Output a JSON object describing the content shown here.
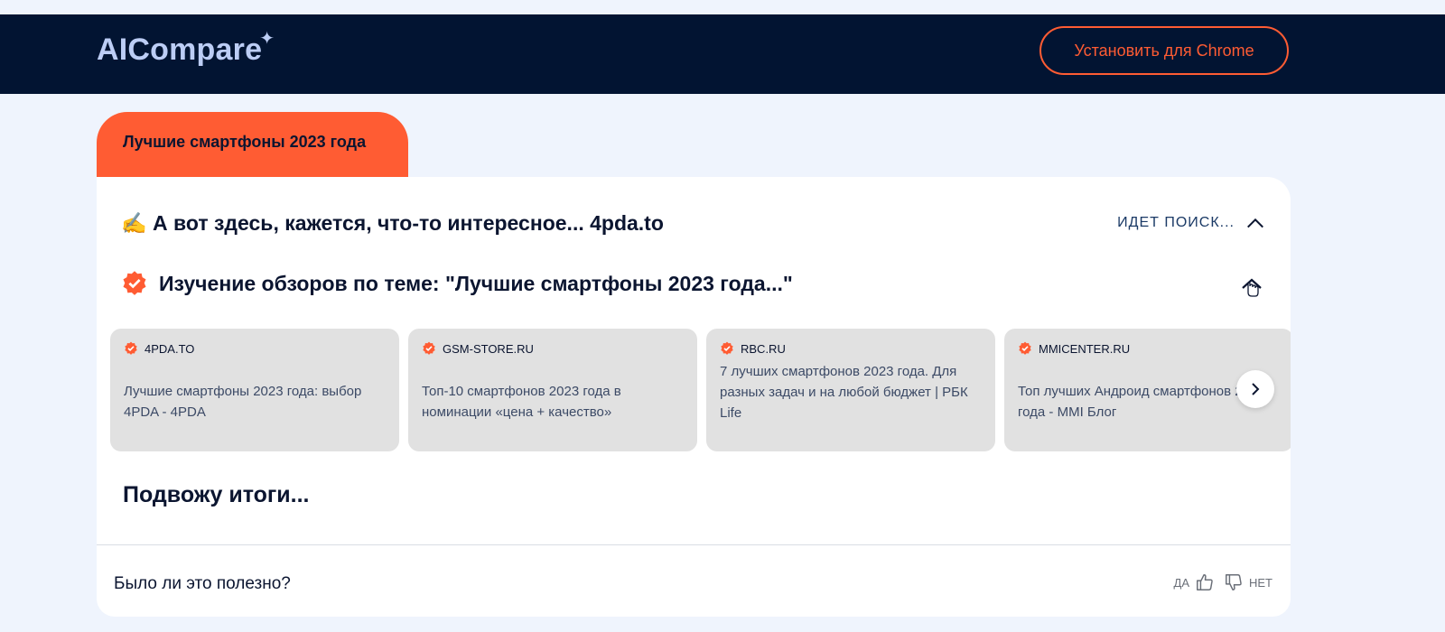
{
  "header": {
    "logo_text": "AICompare",
    "logo_spark": "✦",
    "install_button": "Установить для Chrome"
  },
  "topic": {
    "label": "Лучшие смартфоны 2023 года"
  },
  "result": {
    "headline_emoji": "✍️",
    "headline": "А вот здесь, кажется, что-то интересное... 4pda.to",
    "status": "ИДЕТ ПОИСК...",
    "step_title": "Изучение обзоров по теме: \"Лучшие смартфоны 2023 года...\"",
    "sources": [
      {
        "domain": "4PDA.TO",
        "title": "Лучшие смартфоны 2023 года: выбор 4PDA - 4PDA"
      },
      {
        "domain": "GSM-STORE.RU",
        "title": "Топ-10 смартфонов 2023 года в номинации «цена + качество»"
      },
      {
        "domain": "RBC.RU",
        "title": "7 лучших смартфонов 2023 года. Для разных задач и на любой бюджет | РБК Life"
      },
      {
        "domain": "MMICENTER.RU",
        "title": "Топ лучших Андроид смартфонов 2023 года - MMI Блог"
      }
    ],
    "summary_heading": "Подвожу итоги..."
  },
  "feedback": {
    "question": "Было ли это полезно?",
    "yes": "ДА",
    "no": "НЕТ"
  },
  "colors": {
    "accent": "#ff5c33",
    "header_bg": "#021432",
    "page_bg": "#eff4fd",
    "card_bg": "#ffffff",
    "source_bg": "#e1e1e1",
    "logo": "#bccdf5"
  },
  "icons": [
    "sparkle-icon",
    "writing-hand-icon",
    "chevron-up-icon",
    "verified-badge-icon",
    "chevron-right-icon",
    "thumbs-up-icon",
    "thumbs-down-icon"
  ]
}
